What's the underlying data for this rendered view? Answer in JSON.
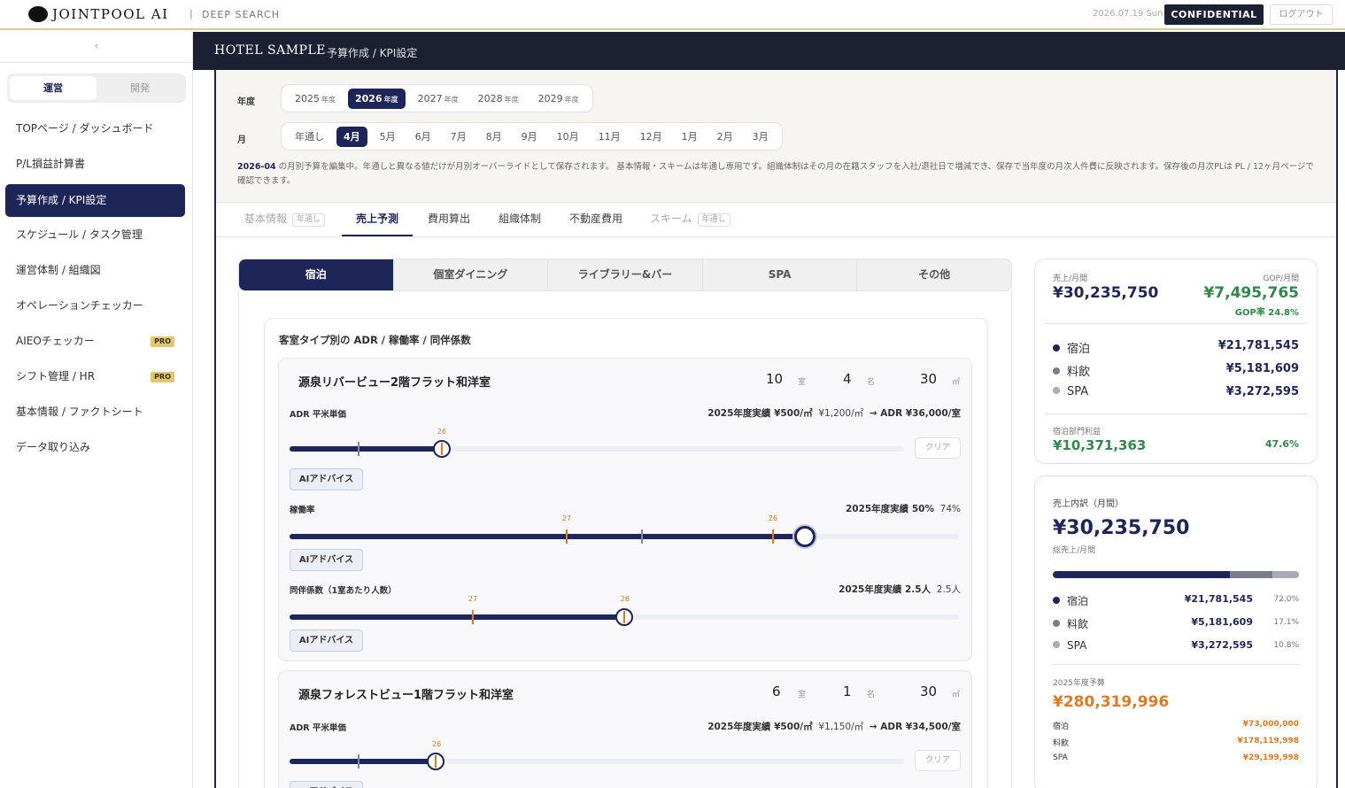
{
  "app": {
    "logo_text": "JOINTPOOL AI",
    "separator": "|",
    "section": "DEEP SEARCH",
    "date": "2026.07.19 Sun",
    "confidential_label": "CONFIDENTIAL",
    "logout_label": "ログアウト"
  },
  "sidebar": {
    "collapse_glyph": "‹",
    "mode_tabs": [
      "運営",
      "開発"
    ],
    "items": [
      {
        "label": "TOPページ / ダッシュボード"
      },
      {
        "label": "P/L損益計算書"
      },
      {
        "label": "予算作成 / KPI設定",
        "active": true
      },
      {
        "label": "スケジュール / タスク管理"
      },
      {
        "label": "運営体制 / 組織図"
      },
      {
        "label": "オペレーションチェッカー"
      },
      {
        "label": "AIEOチェッカー",
        "badge": "PRO"
      },
      {
        "label": "シフト管理 / HR",
        "badge": "PRO"
      },
      {
        "label": "基本情報 / ファクトシート"
      },
      {
        "label": "データ取り込み"
      }
    ]
  },
  "header": {
    "hotel": "HOTEL SAMPLE",
    "breadcrumb": "予算作成 / KPI設定"
  },
  "year_row": {
    "label": "年度",
    "suffix": "年度",
    "years": [
      "2025",
      "2026",
      "2027",
      "2028",
      "2029"
    ],
    "selected": "2026"
  },
  "month_row": {
    "label": "月",
    "months": [
      "年通し",
      "4月",
      "5月",
      "6月",
      "7月",
      "8月",
      "9月",
      "10月",
      "11月",
      "12月",
      "1月",
      "2月",
      "3月"
    ],
    "selected": "4月"
  },
  "notice": {
    "period": "2026-04",
    "text": " の月別予算を編集中。年通しと異なる値だけが月別オーバーライドとして保存されます。 基本情報・スキームは年通し専用です。組織体制はその月の在籍スタッフを入社/退社日で増減でき、保存で当年度の月次人件費に反映されます。保存後の月次PLは PL / 12ヶ月ページで確認できます。"
  },
  "tabs": [
    {
      "label": "基本情報",
      "tag": "年通し"
    },
    {
      "label": "売上予測"
    },
    {
      "label": "費用算出"
    },
    {
      "label": "組織体制"
    },
    {
      "label": "不動産費用"
    },
    {
      "label": "スキーム",
      "tag": "年通し"
    }
  ],
  "segments": [
    "宿泊",
    "個室ダイニング",
    "ライブラリー&バー",
    "SPA",
    "その他"
  ],
  "section_title": "客室タイプ別の ADR / 稼働率 / 同伴係数",
  "rooms": [
    {
      "name": "源泉リバービュー2階フラット和洋室",
      "rooms": "10",
      "rooms_unit": "室",
      "guests": "4",
      "guests_unit": "名",
      "area": "30",
      "area_unit": "㎡",
      "adr": {
        "label": "ADR 平米単価",
        "actual": "2025年度実績 ¥500/㎡",
        "value": "¥1,200/㎡",
        "result": "→ ADR ¥36,000/室",
        "marker": "26",
        "clear": "クリア",
        "level": 0.248
      },
      "occ": {
        "label": "稼働率",
        "actual": "2025年度実績 50%",
        "value": "74%",
        "marker_a": "27",
        "marker_b": "26",
        "level": 0.77
      },
      "comp": {
        "label": "同伴係数（1室あたり人数）",
        "actual": "2025年度実績 2.5人",
        "value": "2.5人",
        "marker_a": "27",
        "marker_b": "26",
        "level": 0.5
      },
      "ai_label": "AIアドバイス"
    },
    {
      "name": "源泉フォレストビュー1階フラット和洋室",
      "rooms": "6",
      "rooms_unit": "室",
      "guests": "1",
      "guests_unit": "名",
      "area": "30",
      "area_unit": "㎡",
      "adr": {
        "label": "ADR 平米単価",
        "actual": "2025年度実績 ¥500/㎡",
        "value": "¥1,150/㎡",
        "result": "→ ADR ¥34,500/室",
        "marker": "26",
        "clear": "クリア",
        "level": 0.238
      }
    }
  ],
  "summary": {
    "sales_label": "売上/月間",
    "sales": "¥30,235,750",
    "gop_label": "GOP/月間",
    "gop": "¥7,495,765",
    "gop_rate": "GOP率 24.8%",
    "lines": [
      {
        "name": "宿泊",
        "value": "¥21,781,545",
        "color": "#1e2559"
      },
      {
        "name": "料飲",
        "value": "¥5,181,609",
        "color": "#7a7d8c"
      },
      {
        "name": "SPA",
        "value": "¥3,272,595",
        "color": "#a9abb8"
      }
    ],
    "dept_profit_label": "宿泊部門利益",
    "dept_profit": "¥10,371,363",
    "dept_profit_rate": "47.6%"
  },
  "breakdown": {
    "title": "売上内訳（月間）",
    "total": "¥30,235,750",
    "total_label": "総売上/月間",
    "shares": [
      0.72,
      0.171,
      0.108
    ],
    "lines": [
      {
        "name": "宿泊",
        "value": "¥21,781,545",
        "pct": "72.0%"
      },
      {
        "name": "料飲",
        "value": "¥5,181,609",
        "pct": "17.1%"
      },
      {
        "name": "SPA",
        "value": "¥3,272,595",
        "pct": "10.8%"
      }
    ],
    "budget_label": "2025年度予算",
    "budget": "¥280,319,996",
    "budget_lines": [
      {
        "name": "宿泊",
        "value": "¥73,000,000"
      },
      {
        "name": "料飲",
        "value": "¥178,119,998"
      },
      {
        "name": "SPA",
        "value": "¥29,199,998"
      }
    ]
  }
}
